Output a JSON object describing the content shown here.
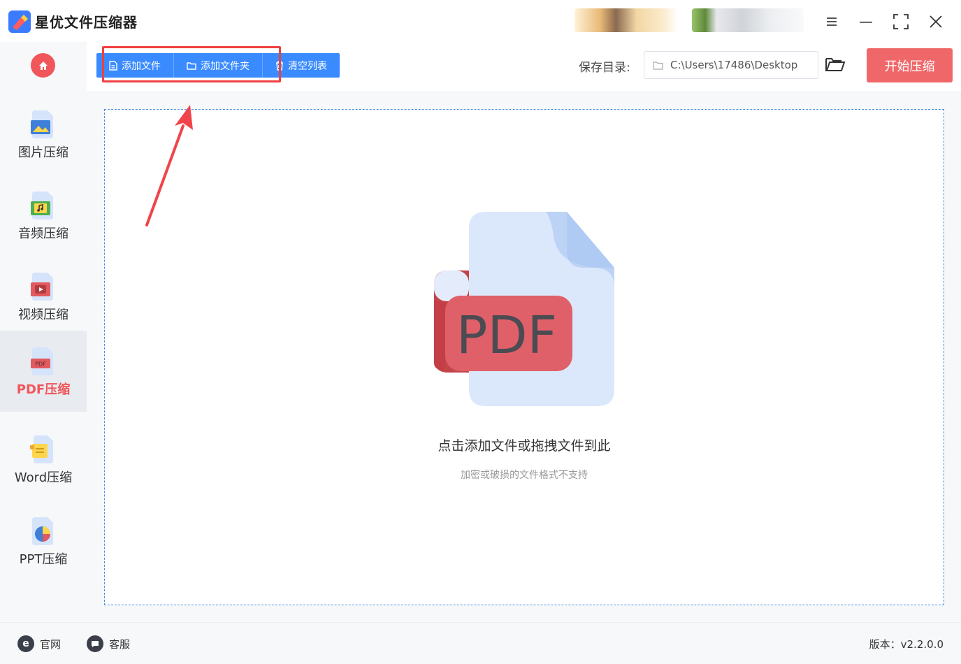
{
  "app": {
    "title": "星优文件压缩器"
  },
  "sidebar": {
    "items": [
      {
        "label": "图片压缩",
        "icon": "image-file-icon"
      },
      {
        "label": "音频压缩",
        "icon": "audio-file-icon"
      },
      {
        "label": "视频压缩",
        "icon": "video-file-icon"
      },
      {
        "label": "PDF压缩",
        "icon": "pdf-file-icon",
        "active": true
      },
      {
        "label": "Word压缩",
        "icon": "word-file-icon"
      },
      {
        "label": "PPT压缩",
        "icon": "ppt-file-icon"
      }
    ]
  },
  "toolbar": {
    "add_file": "添加文件",
    "add_folder": "添加文件夹",
    "clear_list": "清空列表",
    "save_dir_label": "保存目录:",
    "save_dir_value": "C:\\Users\\17486\\Desktop",
    "start_button": "开始压缩"
  },
  "dropzone": {
    "graphic_text": "PDF",
    "main_text": "点击添加文件或拖拽文件到此",
    "sub_text": "加密或破损的文件格式不支持"
  },
  "footer": {
    "website": "官网",
    "support": "客服",
    "version": "版本：v2.2.0.0"
  },
  "colors": {
    "accent_blue": "#3a8bff",
    "accent_red": "#f0676a",
    "highlight_red": "#f04040"
  }
}
